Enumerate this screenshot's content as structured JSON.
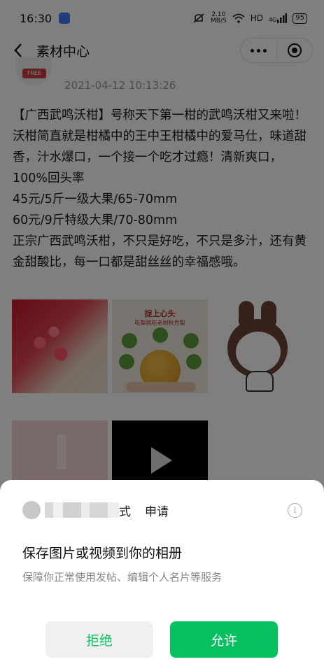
{
  "status_bar": {
    "time": "16:30",
    "network_speed_value": "2.10",
    "network_speed_unit": "MB/S",
    "hd": "HD",
    "signal": "4G",
    "battery": "95"
  },
  "nav": {
    "title": "素材中心",
    "back_icon": "chevron-left-icon",
    "more_icon": "more-dots-icon",
    "close_icon": "target-circle-icon"
  },
  "post": {
    "avatar_tag": "FREE",
    "timestamp": "2021-04-12 10:13:26",
    "lines": [
      "【广西武鸣沃柑】号称天下第一柑的武鸣沃柑又来啦！",
      "沃柑简直就是柑橘中的王中王柑橘中的爱马仕，味道甜香，汁水爆口，一个接一个吃才过瘾！清新爽口，100%回头率",
      "45元/5斤一级大果/65-70mm",
      "60元/9斤特级大果/70-80mm",
      "正宗广西武鸣沃柑，不只是好吃，不只是多汁，还有黄金甜酸比，每一口都是甜丝丝的幸福感哦。"
    ],
    "images": {
      "pear_head": "捉上心头",
      "pear_subhead": "吃梨就吃老树秋月梨"
    }
  },
  "sheet": {
    "app_name_suffix": "式",
    "apply": "申请",
    "info_icon": "info-icon",
    "permission_title": "保存图片或视频到你的相册",
    "permission_desc": "保障你正常使用发帖、编辑个人名片等服务",
    "reject_label": "拒绝",
    "allow_label": "允许"
  },
  "colors": {
    "accent_green": "#07c160",
    "overlay": "rgba(0,0,0,0.5)"
  }
}
